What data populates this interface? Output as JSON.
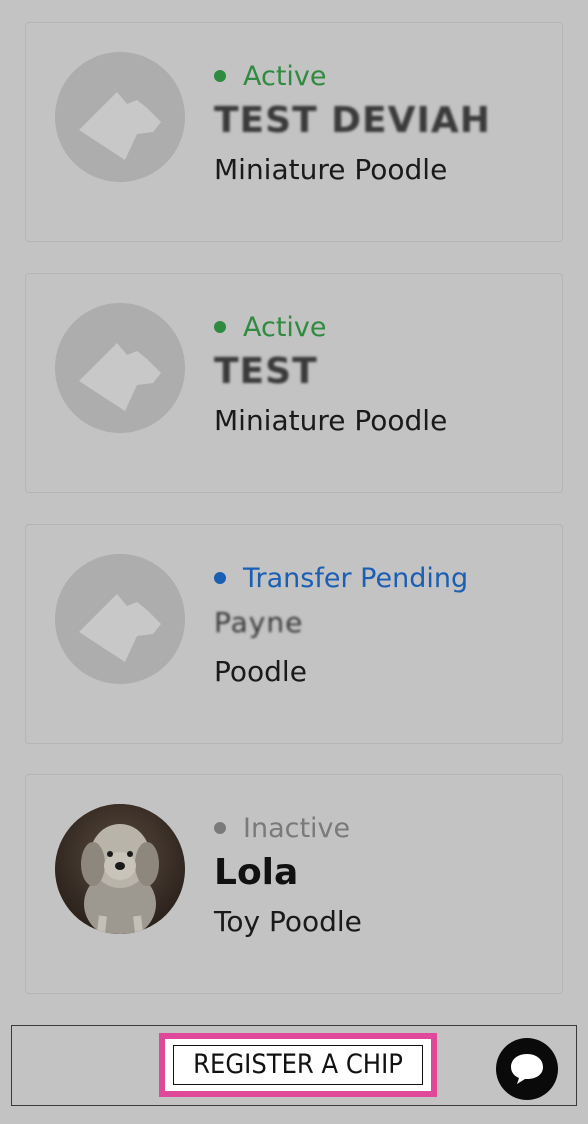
{
  "pets": [
    {
      "status": "Active",
      "status_color": "#2e8b3f",
      "name": "TEST DEVIAH",
      "name_redacted": true,
      "breed": "Miniature Poodle",
      "avatar": "dog-silhouette-icon"
    },
    {
      "status": "Active",
      "status_color": "#2e8b3f",
      "name": "TEST",
      "name_redacted": true,
      "breed": "Miniature Poodle",
      "avatar": "dog-silhouette-icon"
    },
    {
      "status": "Transfer Pending",
      "status_color": "#1a5fb4",
      "name": "Payne",
      "name_redacted": true,
      "breed": "Poodle",
      "avatar": "dog-silhouette-icon"
    },
    {
      "status": "Inactive",
      "status_color": "#7a7a7a",
      "name": "Lola",
      "name_redacted": false,
      "breed": "Toy Poodle",
      "avatar": "dog-photo"
    }
  ],
  "bottom_bar": {
    "register_label": "REGISTER A CHIP",
    "highlight_color": "#e0489a",
    "chat_icon": "chat-bubble-icon"
  }
}
